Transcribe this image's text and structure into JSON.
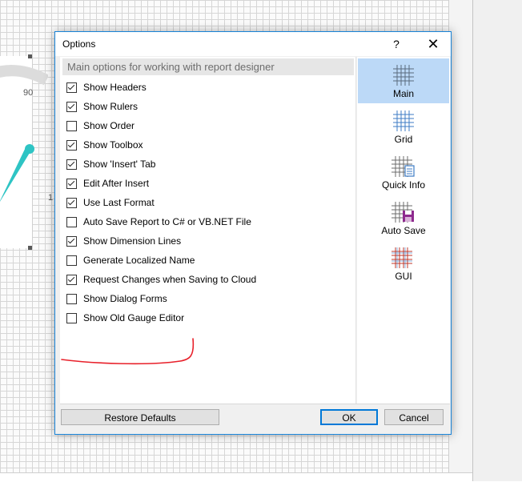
{
  "designer": {
    "gauge_tick_top": "90",
    "gauge_tick_side": "1"
  },
  "dialog": {
    "title": "Options",
    "help_label": "?",
    "close_label": "✕",
    "section_header": "Main options for working with report designer",
    "options": [
      {
        "label": "Show Headers",
        "checked": true
      },
      {
        "label": "Show Rulers",
        "checked": true
      },
      {
        "label": "Show Order",
        "checked": false
      },
      {
        "label": "Show Toolbox",
        "checked": true
      },
      {
        "label": "Show 'Insert' Tab",
        "checked": true
      },
      {
        "label": "Edit After Insert",
        "checked": true
      },
      {
        "label": "Use Last Format",
        "checked": true
      },
      {
        "label": "Auto Save Report to C# or VB.NET File",
        "checked": false
      },
      {
        "label": "Show Dimension Lines",
        "checked": true
      },
      {
        "label": "Generate Localized Name",
        "checked": false
      },
      {
        "label": "Request Changes when Saving to Cloud",
        "checked": true
      },
      {
        "label": "Show Dialog Forms",
        "checked": false
      },
      {
        "label": "Show Old Gauge Editor",
        "checked": false
      }
    ],
    "categories": [
      {
        "label": "Main",
        "icon": "main-grid-icon",
        "selected": true
      },
      {
        "label": "Grid",
        "icon": "grid-icon",
        "selected": false
      },
      {
        "label": "Quick Info",
        "icon": "quick-info-icon",
        "selected": false
      },
      {
        "label": "Auto Save",
        "icon": "auto-save-icon",
        "selected": false
      },
      {
        "label": "GUI",
        "icon": "gui-icon",
        "selected": false
      }
    ],
    "buttons": {
      "restore_defaults": "Restore Defaults",
      "ok": "OK",
      "cancel": "Cancel"
    }
  },
  "colors": {
    "selection": "#bcd9f7",
    "dialog_border": "#1883d7",
    "annotation_red": "#e8202a",
    "gauge_needle": "#2ec4c4"
  }
}
